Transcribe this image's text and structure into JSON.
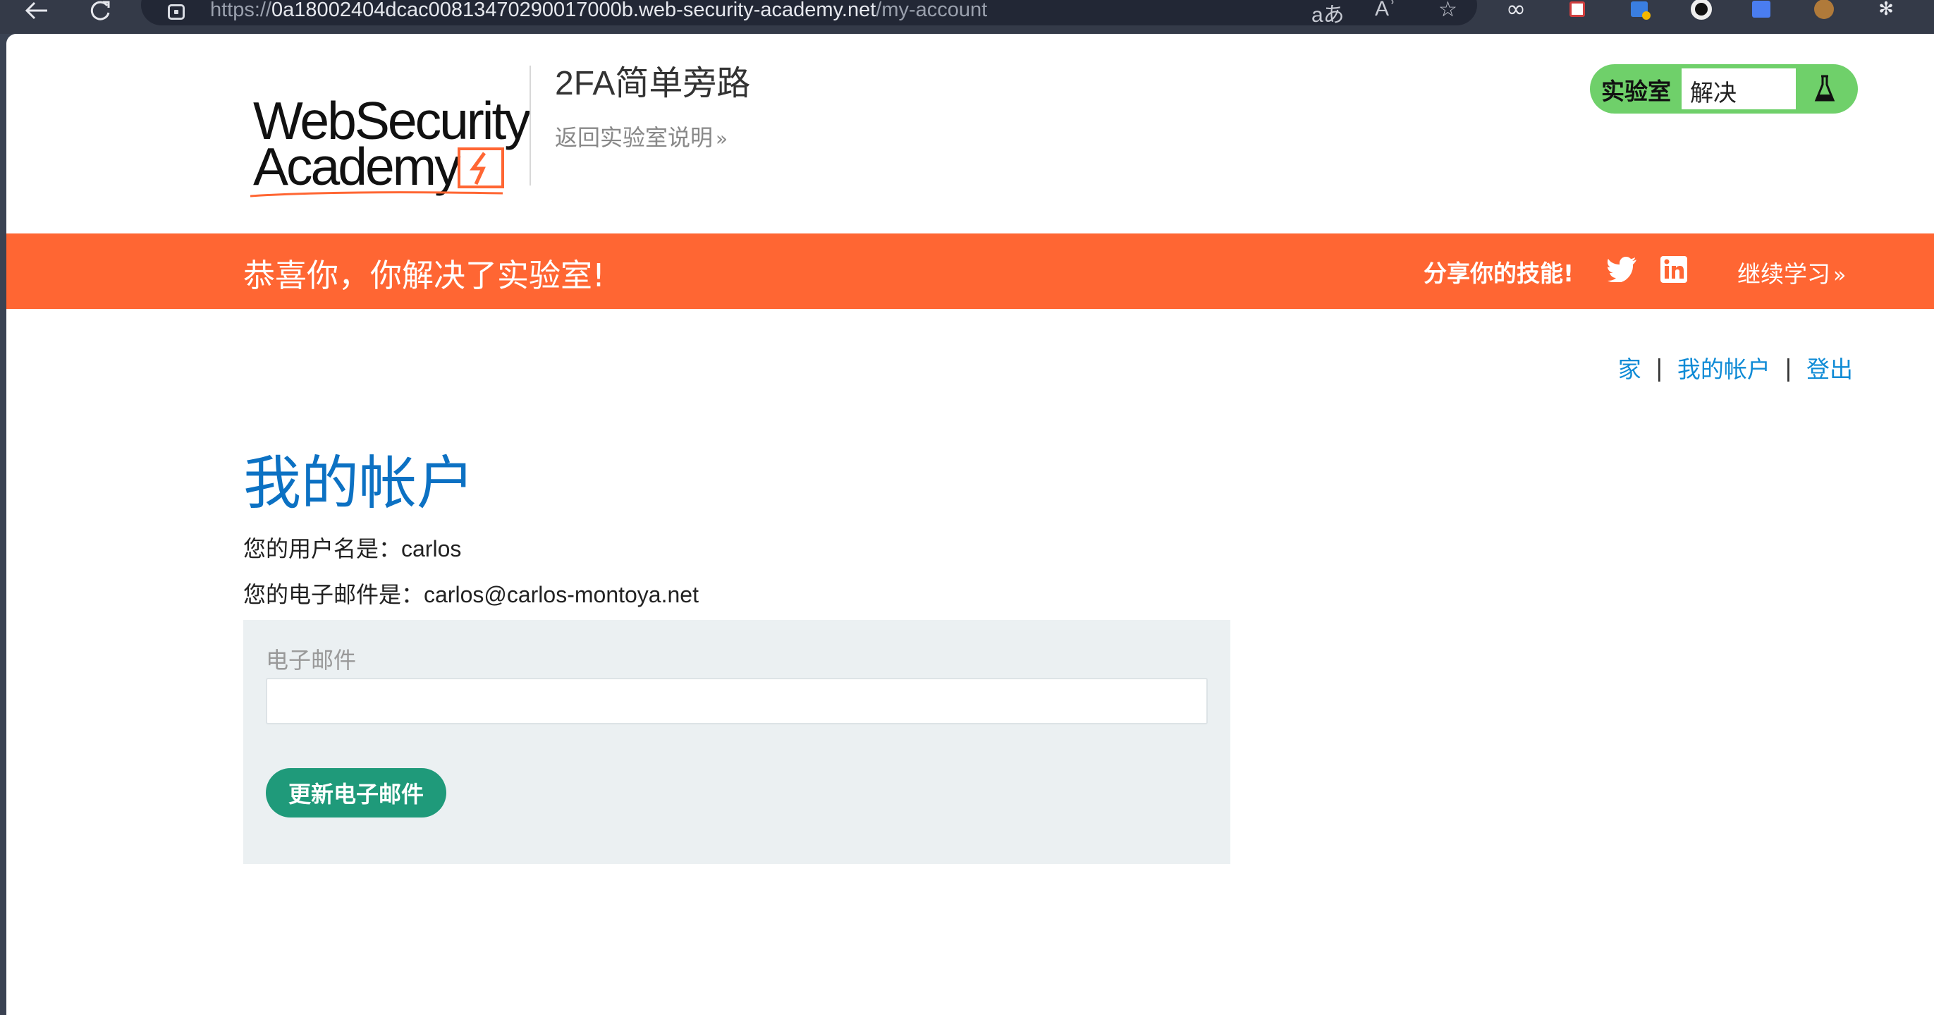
{
  "browser": {
    "url_prefix": "https://",
    "url_host": "0a18002404dcac00813470290017000b.web-security-academy.net",
    "url_path": "/my-account",
    "translate_glyph": "aあ",
    "read_aloud_glyph": "Aʾ",
    "favorite_glyph": "☆",
    "ext_infinity_glyph": "∞",
    "ext_puzzle_glyph": "✻"
  },
  "header": {
    "logo_line1": "WebSecurity",
    "logo_line2": "Academy",
    "lab_title": "2FA简单旁路",
    "back_link": "返回实验室说明",
    "back_chevron": "»",
    "lab_status_label": "实验室",
    "lab_status_value": "解决"
  },
  "banner": {
    "message": "恭喜你，你解决了实验室!",
    "share_label": "分享你的技能!",
    "continue_label": "继续学习",
    "continue_chevron": "»",
    "color": "#ff6633"
  },
  "nav": {
    "home": "家",
    "sep1": "|",
    "my_account": "我的帐户",
    "sep2": "|",
    "logout": "登出"
  },
  "main": {
    "title": "我的帐户",
    "username_line": "您的用户名是：carlos",
    "email_line": "您的电子邮件是：carlos@carlos-montoya.net",
    "email_field_label": "电子邮件",
    "email_field_value": "",
    "update_button": "更新电子邮件"
  },
  "colors": {
    "accent_blue": "#0c71c3",
    "link_blue": "#0f8bd6",
    "status_green": "#6fd06a",
    "button_green": "#1f9a7a"
  }
}
